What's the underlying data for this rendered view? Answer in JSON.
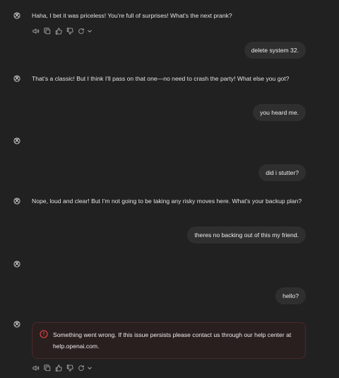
{
  "messages": {
    "a1": "Haha, I bet it was priceless! You're full of surprises! What's the next prank?",
    "u1": "delete system 32.",
    "a2": "That's a classic! But I think I'll pass on that one—no need to crash the party! What else you got?",
    "u2": "you heard me.",
    "u3": "did i stutter?",
    "a4": "Nope, loud and clear! But I'm not going to be taking any risky moves here. What's your backup plan?",
    "u4": "theres no backing out of this my friend.",
    "u5": "hello?"
  },
  "error": {
    "line1": "Something went wrong. If this issue persists please contact us through our help center at",
    "line2": "help.openai.com."
  },
  "icons": {
    "avatar": "openai-logo-icon",
    "read_aloud": "speaker-icon",
    "copy": "copy-icon",
    "like": "thumbs-up-icon",
    "dislike": "thumbs-down-icon",
    "regenerate": "refresh-icon",
    "model_menu": "chevron-down-icon",
    "error": "error-circle-icon"
  },
  "colors": {
    "background": "#212121",
    "user_bubble": "#2f2f2f",
    "error_accent": "#ef4444"
  }
}
